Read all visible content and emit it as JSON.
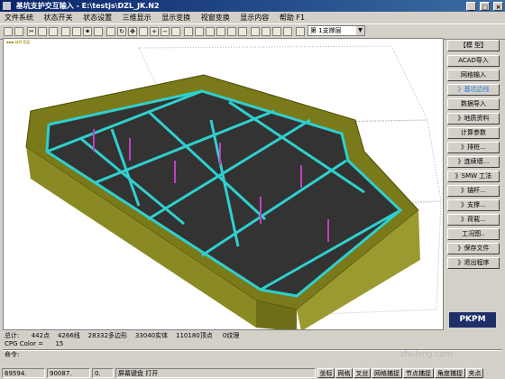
{
  "window": {
    "title": "基坑支护交互输入 - E:\\testjs\\DZL_JK.N2",
    "buttons": [
      "_",
      "□",
      "×"
    ]
  },
  "menu": [
    "文件系统",
    "状态开关",
    "状态设置",
    "三维显示",
    "显示变换",
    "视窗变换",
    "显示内容",
    "帮助 F1"
  ],
  "toolbar": {
    "layer_value": "第 1支撑层"
  },
  "canvas": {
    "stamp": "▪▪▪ 轴线 图层"
  },
  "side": {
    "buttons": [
      "【模 型】",
      "ACAD导入",
      "网格输入",
      "》基坑边线",
      "数据导入",
      "》地质资料",
      "计算参数",
      "》排桩...",
      "》连续墙...",
      "》SMW 工法",
      "》锚杆...",
      "》支撑...",
      "》荷载...",
      "工况图..",
      "》保存文件",
      "》退出程序"
    ],
    "active_index": 3,
    "logo": "PKPM"
  },
  "status": {
    "line1": "总计:      442点    4266线    28332多边形    33040实体    110180顶点     0纹理",
    "line2": "CPG Color =      15",
    "line3": "命令:"
  },
  "bottom": {
    "coord_x": "69594.",
    "coord_y": "90087.",
    "coord_z": "0.",
    "hint": "屏幕键盘 打开",
    "modes": [
      "坐标",
      "网格",
      "叉丝",
      "网格捕捉",
      "节点捕捉",
      "角度捕捉",
      "夹点"
    ]
  },
  "watermark": "zhulong.com"
}
